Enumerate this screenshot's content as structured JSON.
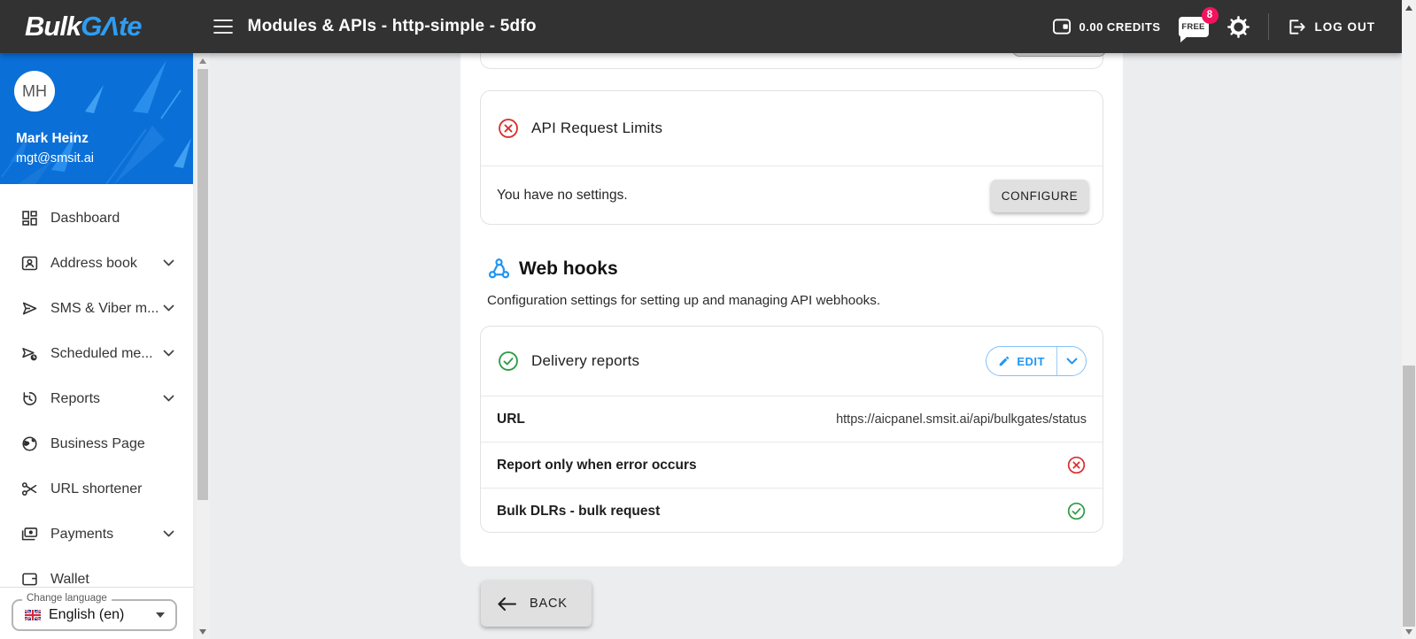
{
  "topbar": {
    "brand_bulk": "Bulk",
    "brand_gate": "GΛte",
    "page_title": "Modules & APIs - http-simple - 5dfo",
    "credits_label": "0.00 CREDITS",
    "free_badge_label": "FREE",
    "free_badge_count": "8",
    "logout_label": "LOG OUT"
  },
  "sidebar": {
    "user": {
      "initials": "MH",
      "name": "Mark Heinz",
      "email": "mgt@smsit.ai"
    },
    "items": [
      {
        "label": "Dashboard"
      },
      {
        "label": "Address book"
      },
      {
        "label": "SMS & Viber m..."
      },
      {
        "label": "Scheduled me..."
      },
      {
        "label": "Reports"
      },
      {
        "label": "Business Page"
      },
      {
        "label": "URL shortener"
      },
      {
        "label": "Payments"
      },
      {
        "label": "Wallet"
      }
    ],
    "language": {
      "legend": "Change language",
      "value": "English (en)"
    }
  },
  "main": {
    "api_limits": {
      "title": "API Request Limits",
      "status": "error",
      "body": "You have no settings.",
      "action_label": "CONFIGURE"
    },
    "webhooks_section": {
      "title": "Web hooks",
      "subtitle": "Configuration settings for setting up and managing API webhooks."
    },
    "delivery_reports": {
      "title": "Delivery reports",
      "status": "success",
      "edit_label": "EDIT",
      "rows": [
        {
          "label": "URL",
          "value": "https://aicpanel.smsit.ai/api/bulkgates/status"
        },
        {
          "label": "Report only when error occurs",
          "status": "error"
        },
        {
          "label": "Bulk DLRs - bulk request",
          "status": "success"
        }
      ]
    },
    "back_label": "BACK"
  },
  "colors": {
    "accent": "#2196f3",
    "brand_blue": "#2d9df4",
    "topbar_bg": "#323232",
    "sidebar_header": "#0b6fd8",
    "error": "#d92f2f",
    "success": "#2e9c44",
    "badge_pink": "#f2135f",
    "button_gray": "#e0e0e0",
    "bg": "#ebedee"
  }
}
